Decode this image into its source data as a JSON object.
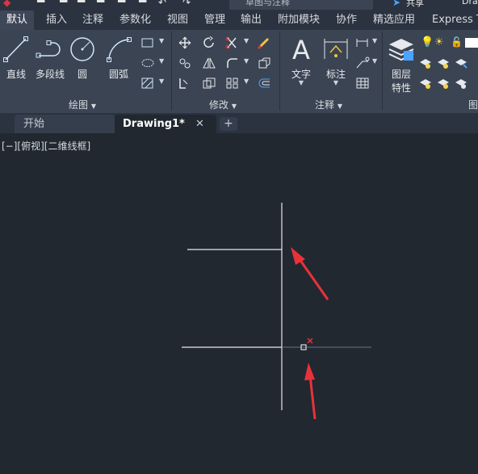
{
  "ribbon_tabs": [
    "默认",
    "插入",
    "注释",
    "参数化",
    "视图",
    "管理",
    "输出",
    "附加模块",
    "协作",
    "精选应用",
    "Express T"
  ],
  "workspace_text": "草图与注释",
  "share_label": "共享",
  "app_title_fragment": "Dra",
  "draw_panel": {
    "title": "绘图",
    "buttons": [
      "直线",
      "多段线",
      "圆",
      "圆弧"
    ]
  },
  "modify_panel": {
    "title": "修改"
  },
  "annotation_panel": {
    "title": "注释",
    "buttons": [
      "文字",
      "标注"
    ]
  },
  "layers_panel": {
    "button_line1": "图层",
    "button_line2": "特性",
    "title_fragment": "图"
  },
  "file_tabs": [
    {
      "label": "开始",
      "active": false
    },
    {
      "label": "Drawing1*",
      "active": true
    }
  ],
  "viewport_label": "[−][俯视][二维线框]",
  "colors": {
    "canvas": "#212830",
    "ribbon": "#3b4452",
    "tabbar": "#2b3340",
    "arrow": "#e8323a"
  }
}
